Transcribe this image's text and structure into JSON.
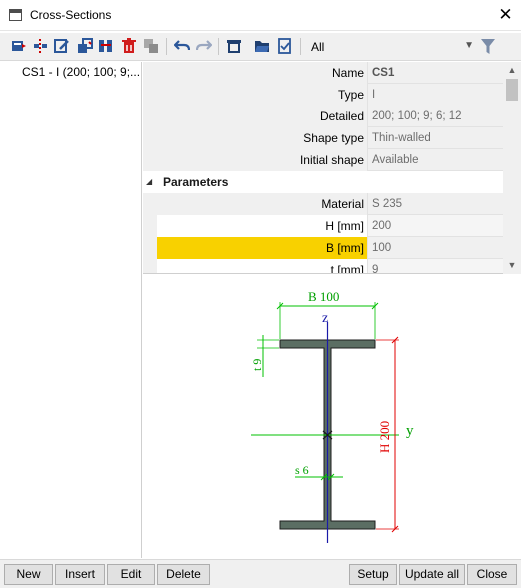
{
  "window": {
    "title": "Cross-Sections",
    "close_label": "✕"
  },
  "toolbar": {
    "buttons": [
      "new-section-icon",
      "insert-section-icon",
      "edit-section-icon",
      "copy-section-icon",
      "replace-section-icon",
      "delete-section-icon",
      "merge-section-icon",
      "undo-icon",
      "redo-icon",
      "print-icon",
      "open-folder-icon",
      "check-icon"
    ],
    "filter_value": "All"
  },
  "tree": {
    "items": [
      {
        "label": "CS1 - I (200; 100; 9;..."
      }
    ]
  },
  "properties": {
    "rows": [
      {
        "label": "Name",
        "value": "CS1"
      },
      {
        "label": "Type",
        "value": "I"
      },
      {
        "label": "Detailed",
        "value": "200; 100; 9; 6; 12"
      },
      {
        "label": "Shape type",
        "value": "Thin-walled"
      },
      {
        "label": "Initial shape",
        "value": "Available"
      }
    ],
    "group": {
      "label": "Parameters"
    },
    "params": [
      {
        "label": "Material",
        "value": "S 235"
      },
      {
        "label": "H [mm]",
        "value": "200"
      },
      {
        "label": "B [mm]",
        "value": "100"
      },
      {
        "label": "t [mm]",
        "value": "9"
      }
    ]
  },
  "preview": {
    "dim_b": "B 100",
    "dim_h": "H 200",
    "dim_t": "t 9",
    "dim_s": "s 6",
    "axis_z": "z",
    "axis_y": "y"
  },
  "buttons": {
    "new": "New",
    "insert": "Insert",
    "edit": "Edit",
    "delete": "Delete",
    "setup": "Setup",
    "update_all": "Update all",
    "close": "Close"
  },
  "colors": {
    "selected_row": "#f8d100",
    "section_fill": "#5b6e63",
    "dim_green": "#00c000",
    "dim_red": "#e00000",
    "axis_blue": "#1a1aa8"
  }
}
